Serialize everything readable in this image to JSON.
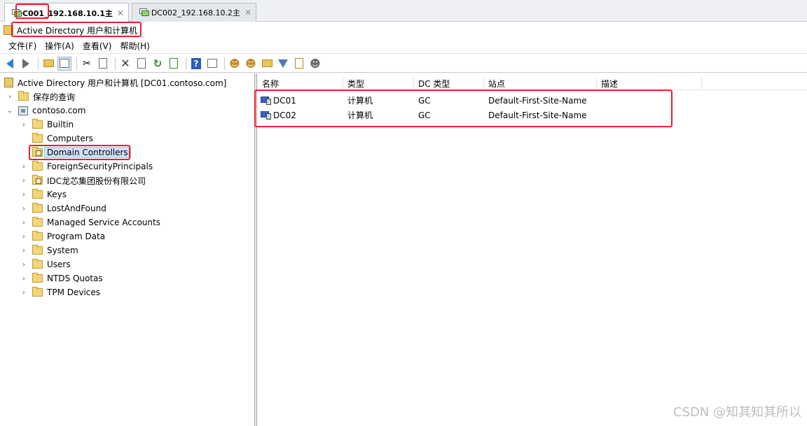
{
  "tabs": [
    {
      "label": "DC001_192.168.10.1主",
      "active": true
    },
    {
      "label": "DC002_192.168.10.2主",
      "active": false
    }
  ],
  "tab_close_glyph": "✕",
  "window_title": "Active Directory 用户和计算机",
  "menu": [
    "文件(F)",
    "操作(A)",
    "查看(V)",
    "帮助(H)"
  ],
  "toolbar_icons": [
    "back-arrow-icon",
    "forward-arrow-icon",
    "up-folder-icon",
    "show-tree-icon",
    "cut-icon",
    "copy-icon",
    "delete-icon",
    "properties-icon",
    "refresh-icon",
    "export-icon",
    "help-icon",
    "view-icon",
    "new-user-icon",
    "new-group-icon",
    "new-ou-icon",
    "filter-icon",
    "find-icon",
    "delegate-icon"
  ],
  "tree": {
    "root": "Active Directory 用户和计算机 [DC01.contoso.com]",
    "saved_queries": "保存的查询",
    "domain": "contoso.com",
    "children": [
      {
        "label": "Builtin",
        "type": "folder",
        "expandable": true
      },
      {
        "label": "Computers",
        "type": "folder",
        "expandable": false
      },
      {
        "label": "Domain Controllers",
        "type": "ou",
        "expandable": false,
        "selected": true
      },
      {
        "label": "ForeignSecurityPrincipals",
        "type": "folder",
        "expandable": true
      },
      {
        "label": "IDC龙芯集团股份有限公司",
        "type": "ou",
        "expandable": true
      },
      {
        "label": "Keys",
        "type": "folder",
        "expandable": true
      },
      {
        "label": "LostAndFound",
        "type": "folder",
        "expandable": true
      },
      {
        "label": "Managed Service Accounts",
        "type": "folder",
        "expandable": true
      },
      {
        "label": "Program Data",
        "type": "folder",
        "expandable": true
      },
      {
        "label": "System",
        "type": "folder",
        "expandable": true
      },
      {
        "label": "Users",
        "type": "folder",
        "expandable": true
      },
      {
        "label": "NTDS Quotas",
        "type": "folder",
        "expandable": true
      },
      {
        "label": "TPM Devices",
        "type": "folder",
        "expandable": true
      }
    ]
  },
  "list": {
    "columns": [
      "名称",
      "类型",
      "DC 类型",
      "站点",
      "描述"
    ],
    "rows": [
      {
        "name": "DC01",
        "type": "计算机",
        "dc_type": "GC",
        "site": "Default-First-Site-Name",
        "desc": ""
      },
      {
        "name": "DC02",
        "type": "计算机",
        "dc_type": "GC",
        "site": "Default-First-Site-Name",
        "desc": ""
      }
    ]
  },
  "watermark": "CSDN @知其知其所以",
  "colors": {
    "annotation": "#e8202a",
    "selection": "#cce4f7"
  }
}
